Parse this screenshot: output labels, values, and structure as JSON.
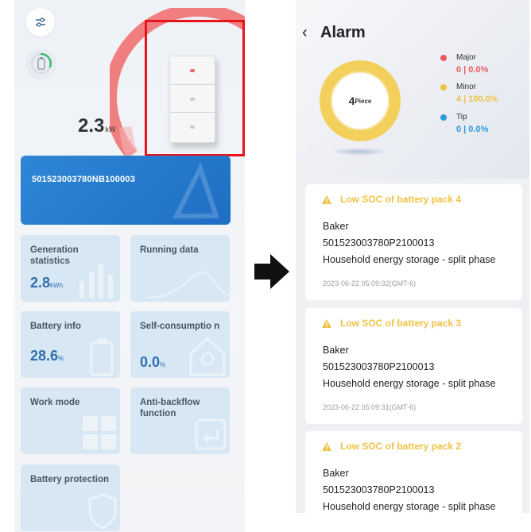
{
  "left_screen": {
    "power": {
      "value": "2.3",
      "unit": "kW"
    },
    "serial_number": "501523003780NB100003",
    "tiles": [
      {
        "title": "Generation statistics",
        "value": "2.8",
        "unit": "kWh"
      },
      {
        "title": "Running data"
      },
      {
        "title": "Battery info",
        "value": "28.6",
        "unit": "%"
      },
      {
        "title": "Self-consumptio n",
        "value": "0.0",
        "unit": "%"
      },
      {
        "title": "Work mode"
      },
      {
        "title": "Anti-backflow function"
      },
      {
        "title": "Battery protection"
      }
    ]
  },
  "right_screen": {
    "back_icon": "‹",
    "title": "Alarm",
    "donut": {
      "count": "4",
      "label": "Piece"
    },
    "legend": [
      {
        "name": "Major",
        "value": "0 | 0.0%",
        "color": "#e95a5a"
      },
      {
        "name": "Minor",
        "value": "4 | 100.0%",
        "color": "#f0c246"
      },
      {
        "name": "Tip",
        "value": "0 | 0.0%",
        "color": "#2b9ae0"
      }
    ],
    "alarms": [
      {
        "title": "Low SOC of battery pack 4",
        "name": "Baker",
        "serial": "501523003780P2100013",
        "type": "Household energy storage - split phase",
        "time": "2023-06-22 05:09:32(GMT-6)"
      },
      {
        "title": "Low SOC of battery pack 3",
        "name": "Baker",
        "serial": "501523003780P2100013",
        "type": "Household energy storage - split phase",
        "time": "2023-06-22 05:09:31(GMT-6)"
      },
      {
        "title": "Low SOC of battery pack 2",
        "name": "Baker",
        "serial": "501523003780P2100013",
        "type": "Household energy storage - split phase",
        "time": ""
      }
    ]
  },
  "colors": {
    "accent_blue": "#2f86d6",
    "highlight_red": "#e8141b",
    "minor_yellow": "#f0c246",
    "tile_bg": "#d7e7f3"
  }
}
